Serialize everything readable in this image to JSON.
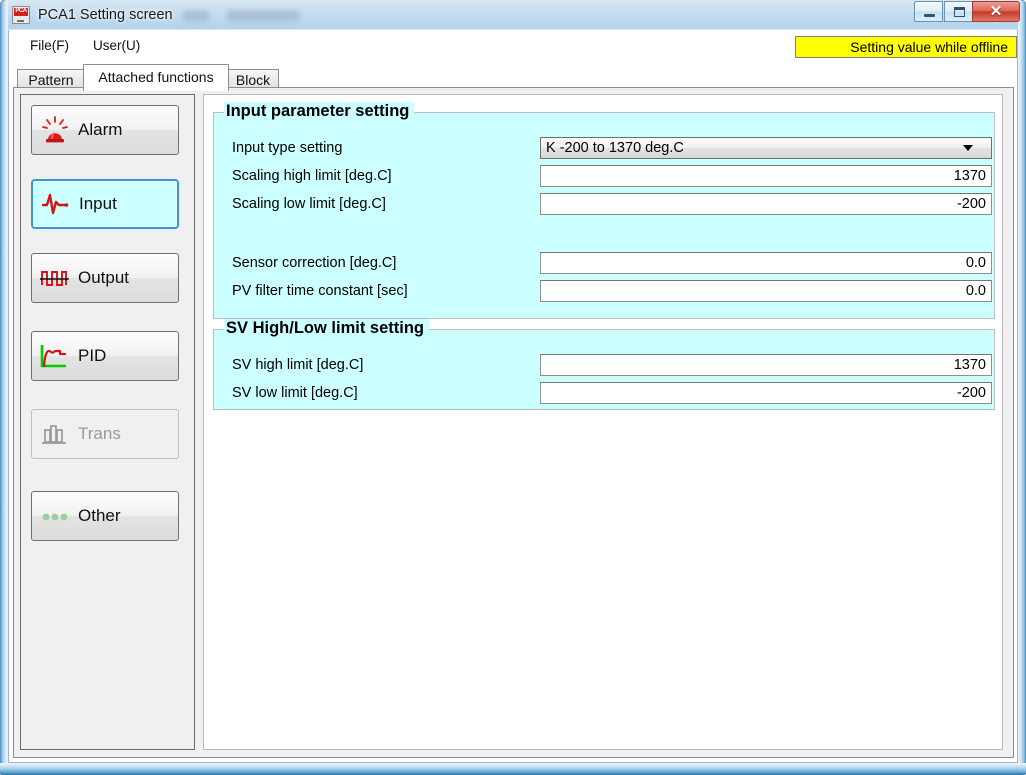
{
  "window": {
    "title": "PCA1 Setting screen",
    "app_icon": "pca-app-icon",
    "controls": {
      "minimize": "minimize-icon",
      "maximize": "maximize-icon",
      "close": "✕"
    }
  },
  "menu": {
    "items": [
      {
        "label": "File(F)",
        "name": "menu-file"
      },
      {
        "label": "User(U)",
        "name": "menu-user"
      }
    ]
  },
  "status": {
    "offline_badge": "Setting value while offline",
    "badge_bg": "#ffff00",
    "badge_fg": "#000000"
  },
  "tabs": [
    {
      "label": "Pattern",
      "active": false
    },
    {
      "label": "Attached functions",
      "active": true
    },
    {
      "label": "Block",
      "active": false
    }
  ],
  "sidebar": {
    "items": [
      {
        "label": "Alarm",
        "icon": "alarm-siren-icon",
        "state": "normal"
      },
      {
        "label": "Input",
        "icon": "pulse-wave-icon",
        "state": "selected"
      },
      {
        "label": "Output",
        "icon": "square-wave-icon",
        "state": "normal"
      },
      {
        "label": "PID",
        "icon": "pid-curve-icon",
        "state": "normal"
      },
      {
        "label": "Trans",
        "icon": "bar-chart-icon",
        "state": "disabled"
      },
      {
        "label": "Other",
        "icon": "three-dots-icon",
        "state": "normal"
      }
    ]
  },
  "content": {
    "groups": [
      {
        "title": "Input parameter setting",
        "fields": [
          {
            "label": "Input type setting",
            "value": "K -200 to 1370 deg.C",
            "control": "combobox"
          },
          {
            "label": "Scaling high limit [deg.C]",
            "value": "1370",
            "control": "textbox"
          },
          {
            "label": "Scaling low limit [deg.C]",
            "value": "-200",
            "control": "textbox"
          },
          {
            "label": "Sensor correction [deg.C]",
            "value": "0.0",
            "control": "textbox"
          },
          {
            "label": "PV filter time constant [sec]",
            "value": "0.0",
            "control": "textbox"
          }
        ]
      },
      {
        "title": "SV High/Low limit setting",
        "fields": [
          {
            "label": "SV high limit [deg.C]",
            "value": "1370",
            "control": "textbox"
          },
          {
            "label": "SV low limit [deg.C]",
            "value": "-200",
            "control": "textbox"
          }
        ]
      }
    ]
  },
  "colors": {
    "panel_cyan": "#ccffff",
    "accent_blue": "#2e9ad6",
    "alarm_red": "#e01b1b",
    "pid_green": "#00cc00",
    "other_green": "#8cc98c"
  }
}
